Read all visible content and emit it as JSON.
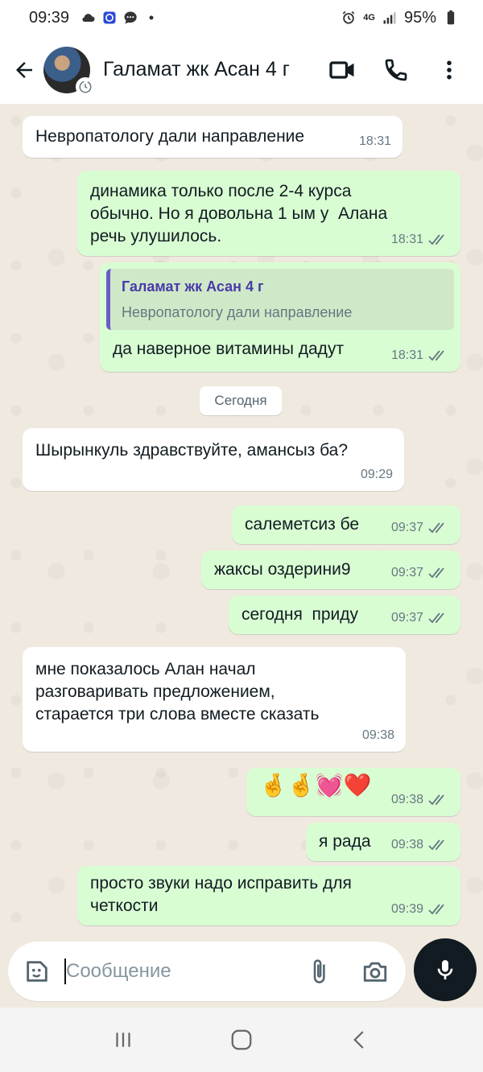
{
  "status_bar": {
    "time": "09:39",
    "battery": "95%",
    "network": "4G"
  },
  "header": {
    "contact_name": "Галамат жк Асан 4 г",
    "icons": [
      "back-arrow-icon",
      "video-call-icon",
      "phone-icon",
      "more-vertical-icon"
    ]
  },
  "messages": [
    {
      "direction": "in",
      "text": "Невропатологу дали направление",
      "time": "18:31"
    },
    {
      "direction": "out",
      "text": "динамика только после 2-4 курса\nобычно. Но я довольна 1 ым у  Алана\nречь улушилось.",
      "time": "18:31"
    },
    {
      "direction": "out",
      "quote_author": "Галамат жк Асан 4 г",
      "quote_text": "Невропатологу дали направление",
      "text": "да наверное витамины дадут",
      "time": "18:31"
    },
    {
      "direction": "in",
      "text": "Шырынкуль здравствуйте, амансыз ба?",
      "time": "09:29"
    },
    {
      "direction": "out",
      "text": "салеметсиз бе",
      "time": "09:37"
    },
    {
      "direction": "out",
      "text": "жаксы оздерини9",
      "time": "09:37"
    },
    {
      "direction": "out",
      "text": "сегодня  приду",
      "time": "09:37"
    },
    {
      "direction": "in",
      "text": "мне показалось Алан начал\nразговаривать предложением,\nстарается три слова вместе сказать",
      "time": "09:38"
    },
    {
      "direction": "out",
      "text": "🤞🤞💓❤️",
      "time": "09:38"
    },
    {
      "direction": "out",
      "text": "я рада",
      "time": "09:38"
    },
    {
      "direction": "out",
      "text": "просто звуки надо исправить для\nчеткости",
      "time": "09:39"
    }
  ],
  "date_separator": "Сегодня",
  "composer": {
    "placeholder": "Сообщение"
  },
  "colors": {
    "outgoing_bubble": "#d9fdd3",
    "incoming_bubble": "#ffffff",
    "chat_background": "#efe9df",
    "quote_bar": "#6b5cc7",
    "mic_button": "#111b21"
  }
}
